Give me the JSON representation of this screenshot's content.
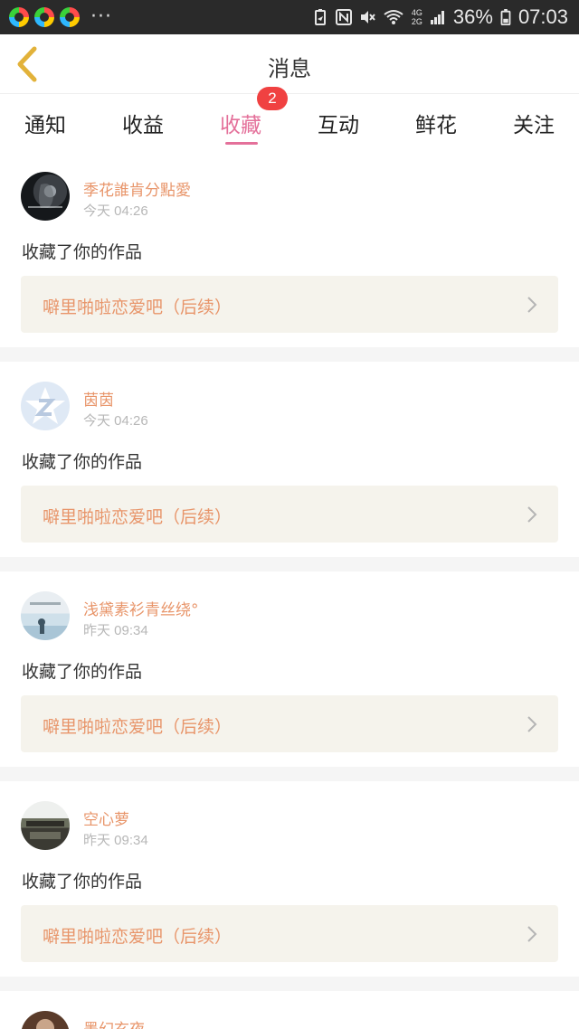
{
  "status_bar": {
    "battery_pct": "36%",
    "time": "07:03",
    "network_labels": [
      "4G",
      "2G"
    ],
    "more": "···"
  },
  "header": {
    "title": "消息"
  },
  "tabs": [
    {
      "label": "通知",
      "active": false
    },
    {
      "label": "收益",
      "active": false
    },
    {
      "label": "收藏",
      "active": true,
      "badge": "2"
    },
    {
      "label": "互动",
      "active": false
    },
    {
      "label": "鲜花",
      "active": false
    },
    {
      "label": "关注",
      "active": false
    }
  ],
  "colors": {
    "accent_pink": "#e4709a",
    "name_orange": "#e8956a",
    "badge_red": "#f04141",
    "card_fill": "#f5f3ec"
  },
  "messages": [
    {
      "user": "季花誰肯分點愛",
      "time": "今天 04:26",
      "action": "收藏了你的作品",
      "work_title": "噼里啪啦恋爱吧（后续）"
    },
    {
      "user": "茵茵",
      "time": "今天 04:26",
      "action": "收藏了你的作品",
      "work_title": "噼里啪啦恋爱吧（后续）"
    },
    {
      "user": "浅黛素衫青丝绕°",
      "time": "昨天 09:34",
      "action": "收藏了你的作品",
      "work_title": "噼里啪啦恋爱吧（后续）"
    },
    {
      "user": "空心萝",
      "time": "昨天 09:34",
      "action": "收藏了你的作品",
      "work_title": "噼里啪啦恋爱吧（后续）"
    },
    {
      "user": "墨幻玄夜",
      "time": "",
      "action": "",
      "work_title": ""
    }
  ]
}
